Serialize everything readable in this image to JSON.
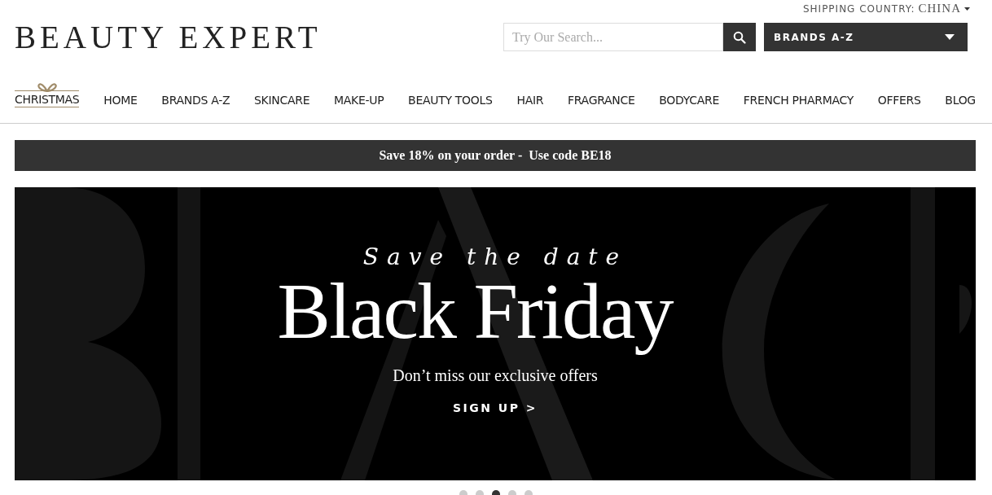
{
  "shipping": {
    "label": "SHIPPING COUNTRY:",
    "country": "CHINA"
  },
  "logo": "BEAUTY EXPERT",
  "search": {
    "placeholder": "Try Our Search..."
  },
  "brands_dropdown": {
    "label": "BRANDS A-Z"
  },
  "nav": [
    {
      "label": "CHRISTMAS",
      "kind": "featured"
    },
    {
      "label": "HOME",
      "kind": "link"
    },
    {
      "label": "BRANDS A-Z",
      "kind": "link"
    },
    {
      "label": "SKINCARE",
      "kind": "link"
    },
    {
      "label": "MAKE-UP",
      "kind": "link"
    },
    {
      "label": "BEAUTY TOOLS",
      "kind": "link"
    },
    {
      "label": "HAIR",
      "kind": "link"
    },
    {
      "label": "FRAGRANCE",
      "kind": "link"
    },
    {
      "label": "BODYCARE",
      "kind": "link"
    },
    {
      "label": "FRENCH PHARMACY",
      "kind": "link"
    },
    {
      "label": "OFFERS",
      "kind": "link"
    },
    {
      "label": "BLOG",
      "kind": "link"
    }
  ],
  "promo": "Save 18% on your order -  Use code BE18",
  "banner": {
    "script_line": "Save the date",
    "headline": "Black Friday",
    "subline": "Don’t miss our exclusive offers",
    "cta": "SIGN UP >"
  },
  "carousel_dots": [
    {
      "selected": false
    },
    {
      "selected": false
    },
    {
      "selected": true
    },
    {
      "selected": false
    },
    {
      "selected": false
    }
  ]
}
